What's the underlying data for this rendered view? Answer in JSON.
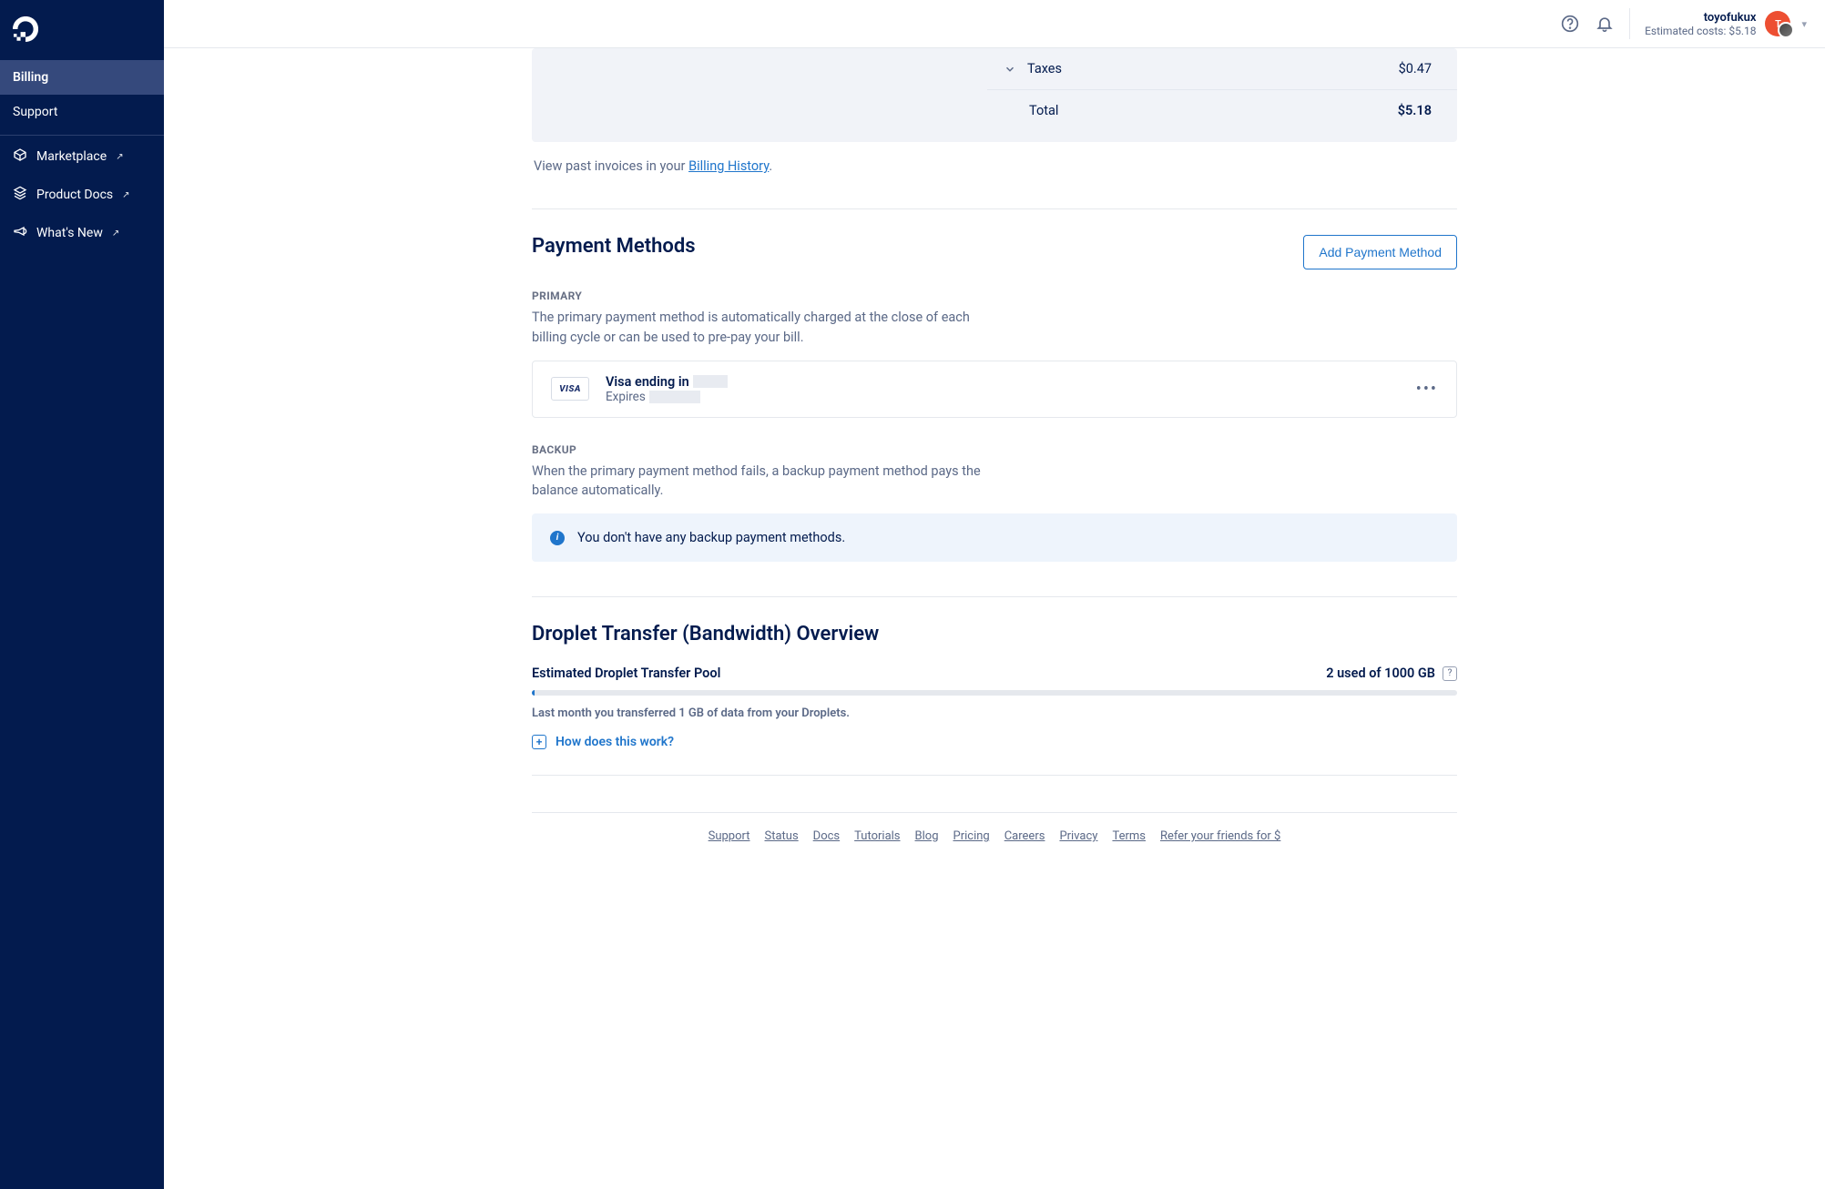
{
  "sidebar": {
    "nav": [
      {
        "label": "Billing"
      },
      {
        "label": "Support"
      }
    ],
    "links": [
      {
        "label": "Marketplace"
      },
      {
        "label": "Product Docs"
      },
      {
        "label": "What's New"
      }
    ]
  },
  "header": {
    "username": "toyofukux",
    "estimated_label": "Estimated costs: $5.18",
    "avatar_initial": "T"
  },
  "summary": {
    "taxes_label": "Taxes",
    "taxes_amount": "$0.47",
    "total_label": "Total",
    "total_amount": "$5.18"
  },
  "past_invoice": {
    "prefix": "View past invoices in your ",
    "link": "Billing History",
    "suffix": "."
  },
  "payment": {
    "title": "Payment Methods",
    "add_button": "Add Payment Method",
    "primary_label": "PRIMARY",
    "primary_desc": "The primary payment method is automatically charged at the close of each billing cycle or can be used to pre-pay your bill.",
    "card_brand": "VISA",
    "card_line1_prefix": "Visa ending in",
    "card_line2_prefix": "Expires",
    "backup_label": "BACKUP",
    "backup_desc": "When the primary payment method fails, a backup payment method pays the balance automatically.",
    "backup_empty": "You don't have any backup payment methods."
  },
  "transfer": {
    "title": "Droplet Transfer (Bandwidth) Overview",
    "pool_label": "Estimated Droplet Transfer Pool",
    "usage": "2 used of 1000 GB",
    "last_month": "Last month you transferred 1 GB of data from your Droplets.",
    "how_link": "How does this work?"
  },
  "footer": {
    "links": [
      "Support",
      "Status",
      "Docs",
      "Tutorials",
      "Blog",
      "Pricing",
      "Careers",
      "Privacy",
      "Terms",
      "Refer your friends for $"
    ]
  }
}
